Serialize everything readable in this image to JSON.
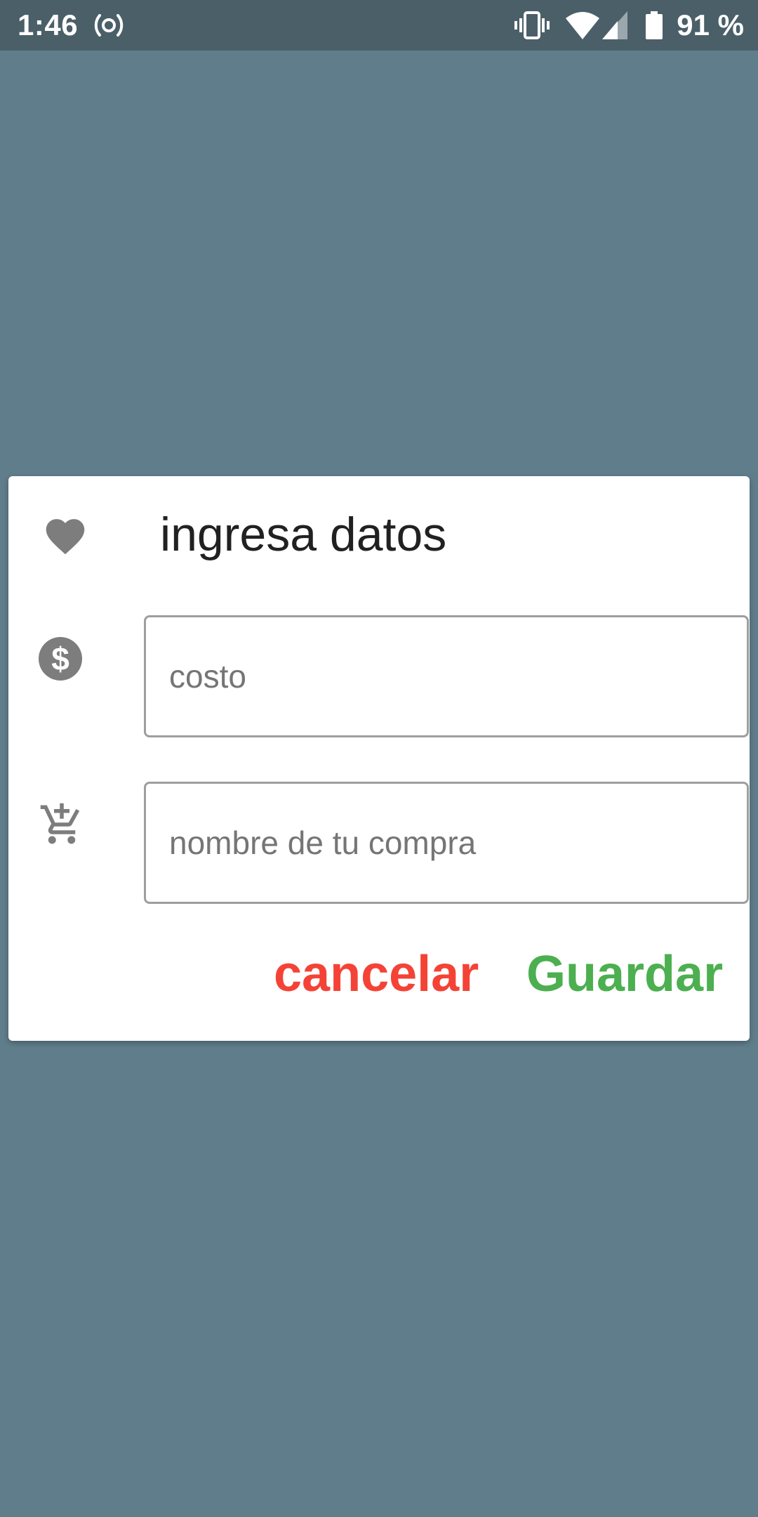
{
  "status_bar": {
    "time": "1:46",
    "battery_percent": "91 %",
    "icons": [
      "hotspot-icon",
      "vibrate-icon",
      "wifi-icon",
      "signal-icon",
      "battery-icon"
    ]
  },
  "dialog": {
    "title": "ingresa datos",
    "title_icon": "heart-icon",
    "fields": {
      "cost": {
        "icon": "dollar-icon",
        "placeholder": "costo",
        "value": ""
      },
      "name": {
        "icon": "add-shopping-cart-icon",
        "placeholder": "nombre de tu compra",
        "value": ""
      }
    },
    "buttons": {
      "cancel_label": "cancelar",
      "save_label": "Guardar"
    }
  },
  "colors": {
    "background": "#607d8b",
    "status_bar": "#4b5f69",
    "cancel": "#f44336",
    "save": "#4caf50",
    "icon_gray": "#7d7d7d"
  }
}
